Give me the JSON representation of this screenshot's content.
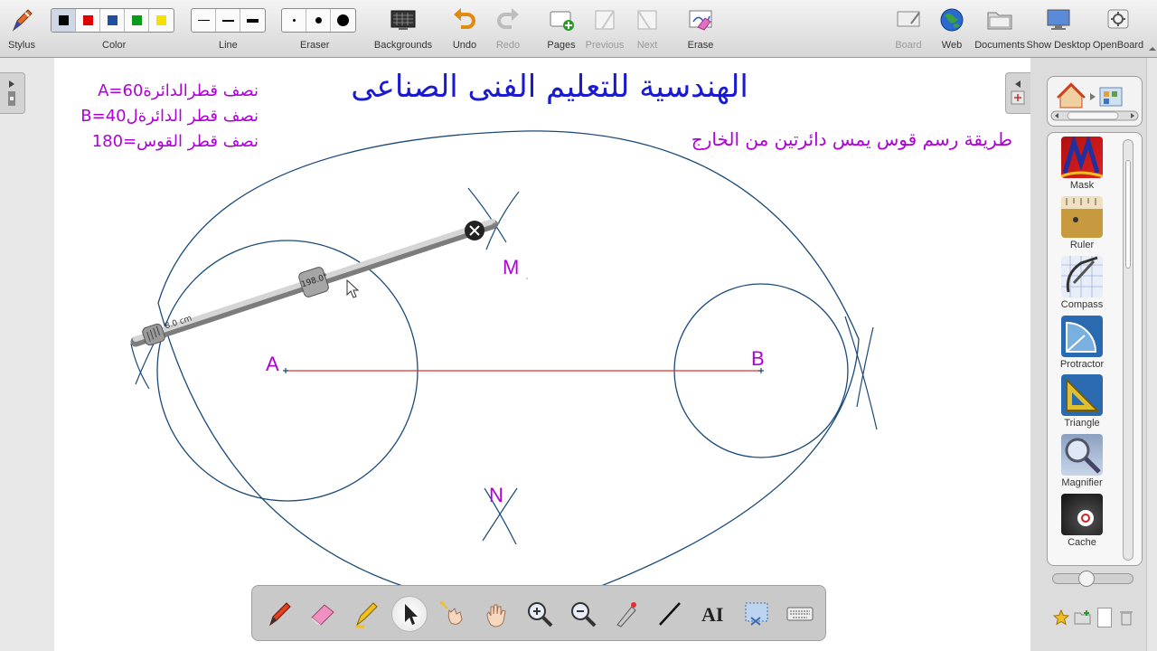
{
  "toolbar": {
    "stylus": "Stylus",
    "color": "Color",
    "line": "Line",
    "eraser": "Eraser",
    "backgrounds": "Backgrounds",
    "undo": "Undo",
    "redo": "Redo",
    "pages": "Pages",
    "previous": "Previous",
    "next": "Next",
    "erase": "Erase",
    "board": "Board",
    "web": "Web",
    "documents": "Documents",
    "show_desktop": "Show Desktop",
    "openboard": "OpenBoard",
    "colors": [
      "#000000",
      "#e00000",
      "#1e4fa0",
      "#0a9a1a",
      "#f5e000"
    ],
    "selected_color": "#000000"
  },
  "board": {
    "title": "الهندسية للتعليم الفنى الصناعى",
    "subtitle": "طريقة رسم قوس يمس دائرتين من الخارج",
    "note_a": "نصف قطرالدائرة60=A",
    "note_b": "نصف قطر الدائرةل40=B",
    "note_arc": "نصف قطر القوس=180",
    "label_a": "A",
    "label_b": "B",
    "label_m": "M",
    "label_n": "N",
    "compass_length": "8.0 cm",
    "compass_angle": "198.0°",
    "title_color": "#1a1ad0",
    "text_color": "#b000d8",
    "circle_color": "#1b4a78",
    "line_color": "#e03030"
  },
  "library": {
    "items": [
      {
        "label": "Mask"
      },
      {
        "label": "Ruler"
      },
      {
        "label": "Compass"
      },
      {
        "label": "Protractor"
      },
      {
        "label": "Triangle"
      },
      {
        "label": "Magnifier"
      },
      {
        "label": "Cache"
      }
    ]
  },
  "bottom_tools": {
    "selected": "pointer-tool"
  }
}
